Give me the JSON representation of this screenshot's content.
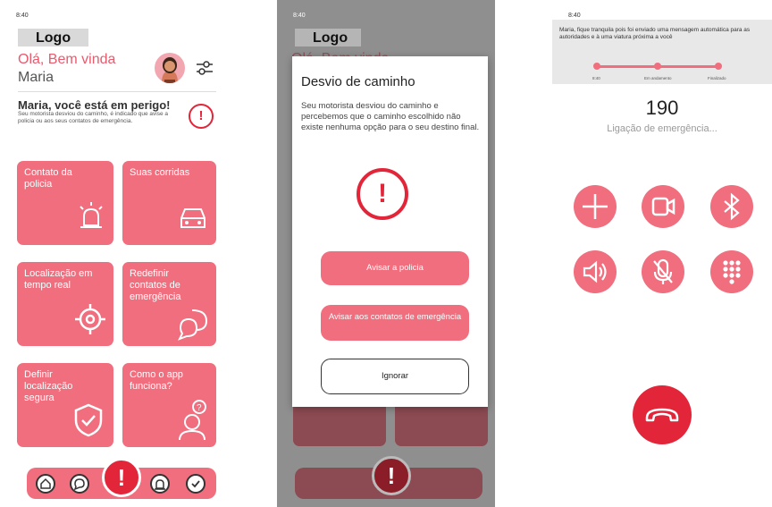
{
  "screen1": {
    "status_time": "8:40",
    "logo": "Logo",
    "greeting": "Olá, Bem vinda",
    "user_name": "Maria",
    "alert_title": "Maria, você está em perigo!",
    "alert_text": "Seu motorista desviou do caminho, é indicado que avise a policia ou aos  seus contatos de emergência.",
    "cards": [
      {
        "label": "Contato da policia",
        "icon": "siren-icon"
      },
      {
        "label": "Suas corridas",
        "icon": "car-icon"
      },
      {
        "label": "Localização em tempo real",
        "icon": "target-icon"
      },
      {
        "label": "Redefinir contatos de emergência",
        "icon": "chat-bubbles-icon"
      },
      {
        "label": "Definir localização segura",
        "icon": "shield-check-icon"
      },
      {
        "label": "Como o app funciona?",
        "icon": "help-person-icon"
      }
    ],
    "nav_icons": [
      "home-icon",
      "chat-icon",
      "alert-icon",
      "siren-icon",
      "check-icon"
    ]
  },
  "screen2": {
    "status_time": "8:40",
    "logo": "Logo",
    "greeting_partial": "Olá, Bem vinda",
    "modal": {
      "title": "Desvio de caminho",
      "body": "Seu motorista desviou do caminho e percebemos que o caminho escolhido não existe nenhuma opção para o seu destino final.",
      "buttons": [
        "Avisar a policia",
        "Avisar aos contatos de emergência",
        "Ignorar"
      ]
    }
  },
  "screen3": {
    "status_time": "8:40",
    "banner_text": "Maria, fique tranquila pois foi enviado uma mensagem automática para as autoridades e à uma viatura próxima a você",
    "steps": [
      "8:40",
      "Em andamento",
      "Finalizado"
    ],
    "call_number": "190",
    "call_label": "Ligação de emergência...",
    "call_buttons": [
      "plus-icon",
      "video-icon",
      "bluetooth-icon",
      "speaker-icon",
      "mute-icon",
      "keypad-icon"
    ]
  },
  "colors": {
    "accent": "#f06e7e",
    "danger": "#e3253a",
    "overlay": "#8f8f8f"
  }
}
